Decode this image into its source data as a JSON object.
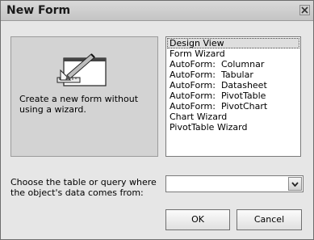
{
  "dialog": {
    "title": "New Form",
    "close_icon": "close-icon"
  },
  "preview": {
    "icon": "form-ruler-icon",
    "description": "Create a new form without using a wizard."
  },
  "list": {
    "items": [
      "Design View",
      "Form Wizard",
      "AutoForm:  Columnar",
      "AutoForm:  Tabular",
      "AutoForm:  Datasheet",
      "AutoForm:  PivotTable",
      "AutoForm:  PivotChart",
      "Chart Wizard",
      "PivotTable Wizard"
    ],
    "selected": "Design View"
  },
  "source": {
    "label": "Choose the table or query where the object's data comes from:",
    "value": "",
    "dropdown_icon": "chevron-down-icon"
  },
  "buttons": {
    "ok": "OK",
    "cancel": "Cancel"
  }
}
